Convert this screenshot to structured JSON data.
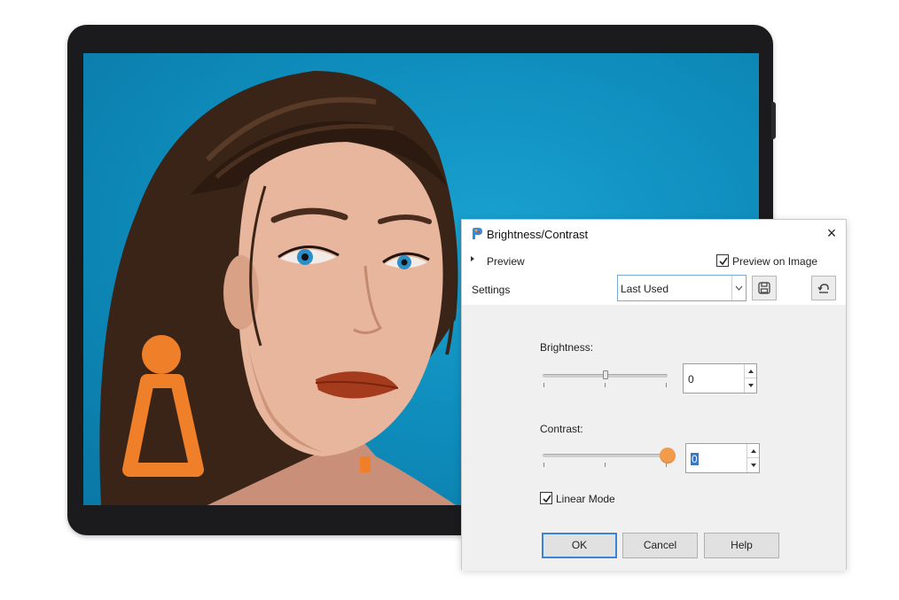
{
  "dialog": {
    "title": "Brightness/Contrast",
    "preview_label": "Preview",
    "preview_on_image_label": "Preview on Image",
    "preview_on_image_checked": true,
    "settings_label": "Settings",
    "settings_value": "Last Used",
    "brightness": {
      "label": "Brightness:",
      "value": "0",
      "level": 0.5
    },
    "contrast": {
      "label": "Contrast:",
      "value": "0",
      "level": 1.0
    },
    "linear_mode_label": "Linear Mode",
    "linear_mode_checked": true,
    "buttons": {
      "ok": "OK",
      "cancel": "Cancel",
      "help": "Help"
    }
  },
  "colors": {
    "background_blue": "#0f8fbe",
    "accent_orange": "#f29b4a",
    "focus_blue": "#3a86d4"
  },
  "icons": [
    "app-icon",
    "close-icon",
    "expand-triangle-icon",
    "check-icon",
    "chevron-down-icon",
    "save-preset-icon",
    "reset-icon"
  ]
}
